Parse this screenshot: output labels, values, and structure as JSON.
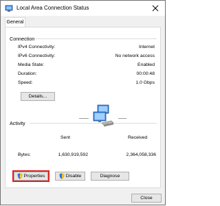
{
  "window": {
    "title": "Local Area Connection Status"
  },
  "tabs": [
    {
      "label": "General"
    }
  ],
  "connection": {
    "heading": "Connection",
    "rows": [
      {
        "label": "IPv4 Connectivity:",
        "value": "Internet"
      },
      {
        "label": "IPv6 Connectivity:",
        "value": "No network access"
      },
      {
        "label": "Media State:",
        "value": "Enabled"
      },
      {
        "label": "Duration:",
        "value": "00:00:48"
      },
      {
        "label": "Speed:",
        "value": "1.0 Gbps"
      }
    ],
    "details_button": "Details..."
  },
  "activity": {
    "heading": "Activity",
    "sent_label": "Sent",
    "received_label": "Received",
    "bytes_label": "Bytes:",
    "bytes_sent": "1,630,919,592",
    "bytes_received": "2,364,058,336"
  },
  "buttons": {
    "properties": "Properties",
    "disable": "Disable",
    "diagnose": "Diagnose",
    "close": "Close"
  },
  "colors": {
    "highlight": "#e0211f",
    "shield_blue": "#2a6fd6",
    "shield_yellow": "#f2c21b"
  }
}
